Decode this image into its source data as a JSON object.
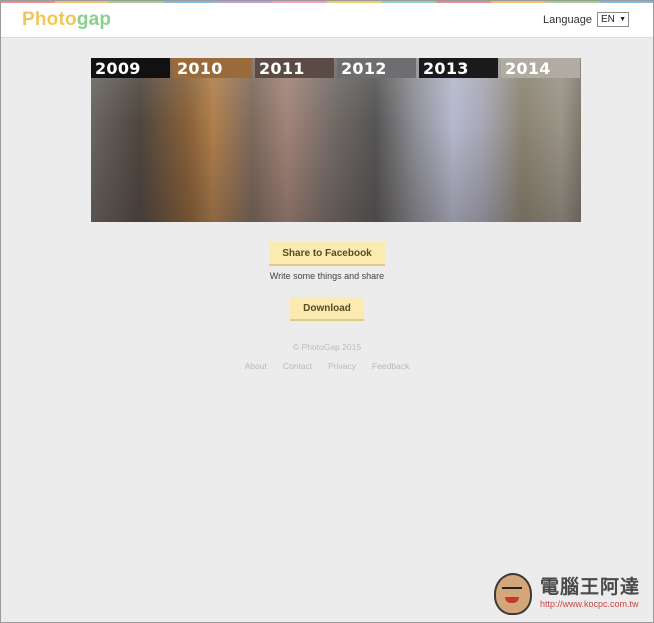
{
  "colors": {
    "stripe": [
      "#e88c8c",
      "#f0c070",
      "#a0d090",
      "#80b8e0",
      "#c0a0d8",
      "#f0a0c0",
      "#e8d070",
      "#90d0c0",
      "#e88c8c",
      "#f0c070",
      "#a0d090",
      "#80b8e0"
    ],
    "button_bg": "#fcebb0",
    "page_bg": "#ececec"
  },
  "header": {
    "logo_part1": "Photo",
    "logo_part2": "gap",
    "language_label": "Language",
    "language_value": "EN",
    "language_arrow": "▼"
  },
  "collage": {
    "years": [
      "2009",
      "2010",
      "2011",
      "2012",
      "2013",
      "2014"
    ]
  },
  "actions": {
    "share_label": "Share to Facebook",
    "share_hint": "Write some things and share",
    "download_label": "Download"
  },
  "footer": {
    "copyright": "© PhotoGap 2015",
    "links": [
      "About",
      "Contact",
      "Privacy",
      "Feedback"
    ]
  },
  "watermark": {
    "title": "電腦王阿達",
    "url": "http://www.kocpc.com.tw"
  }
}
